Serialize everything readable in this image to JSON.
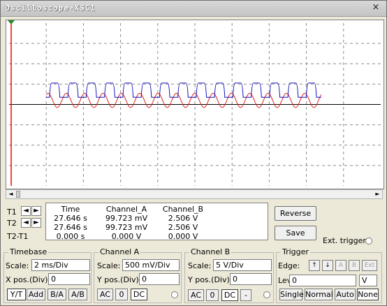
{
  "window": {
    "title": "Oscilloscope-XSC1",
    "close_glyph": "×"
  },
  "scroll": {
    "left_arrow": "◄",
    "right_arrow": "►"
  },
  "cursors": {
    "t1_label": "T1",
    "t2_label": "T2",
    "t2t1_label": "T2-T1",
    "arrow_left": "◄",
    "arrow_right": "►",
    "headers": {
      "time": "Time",
      "channel_a": "Channel_A",
      "channel_b": "Channel_B"
    },
    "rows": [
      {
        "time": "27.646 s",
        "channel_a": "99.723 mV",
        "channel_b": "2.506 V"
      },
      {
        "time": "27.646 s",
        "channel_a": "99.723 mV",
        "channel_b": "2.506 V"
      },
      {
        "time": "0.000 s",
        "channel_a": "0.000 V",
        "channel_b": "0.000 V"
      }
    ]
  },
  "buttons": {
    "reverse": "Reverse",
    "save": "Save",
    "ext_trigger": "Ext. trigger"
  },
  "timebase": {
    "title": "Timebase",
    "scale_label": "Scale:",
    "scale_value": "2 ms/Div",
    "xpos_label": "X pos.(Div):",
    "xpos_value": "0",
    "modes": [
      "Y/T",
      "Add",
      "B/A",
      "A/B"
    ],
    "selected_mode": "Y/T"
  },
  "channel_a": {
    "title": "Channel A",
    "scale_label": "Scale:",
    "scale_value": "500 mV/Div",
    "ypos_label": "Y pos.(Div):",
    "ypos_value": "0",
    "coupling": [
      "AC",
      "0",
      "DC"
    ],
    "selected_coupling": "DC"
  },
  "channel_b": {
    "title": "Channel B",
    "scale_label": "Scale:",
    "scale_value": "5  V/Div",
    "ypos_label": "Y pos.(Div):",
    "ypos_value": "0",
    "coupling": [
      "AC",
      "0",
      "DC",
      "-"
    ],
    "selected_coupling": "DC"
  },
  "trigger": {
    "title": "Trigger",
    "edge_label": "Edge:",
    "edge_buttons": [
      "↑",
      "↓",
      "A",
      "B",
      "Ext"
    ],
    "level_label": "Level:",
    "level_value": "0",
    "level_unit": "V",
    "modes": [
      "Single",
      "Normal",
      "Auto",
      "None"
    ],
    "selected_mode": "None"
  },
  "colors": {
    "channel_a_trace": "#e02020",
    "channel_b_trace": "#1010c0",
    "cursor_t1": "#ff0000",
    "grid": "#8c8c8c",
    "axis": "#000000"
  },
  "chart_data": {
    "type": "line",
    "title": "",
    "xlabel": "",
    "ylabel": "",
    "x_range_div": [
      0,
      10
    ],
    "y_range_div": [
      -4,
      4
    ],
    "grid": true,
    "series": [
      {
        "channel": "A",
        "shape": "sine",
        "cycles": 15,
        "amplitude_div": 0.35,
        "offset_div": 0.2
      },
      {
        "channel": "B",
        "shape": "square",
        "cycles": 15,
        "amplitude_div": 0.35,
        "offset_div": 0.7
      }
    ]
  }
}
